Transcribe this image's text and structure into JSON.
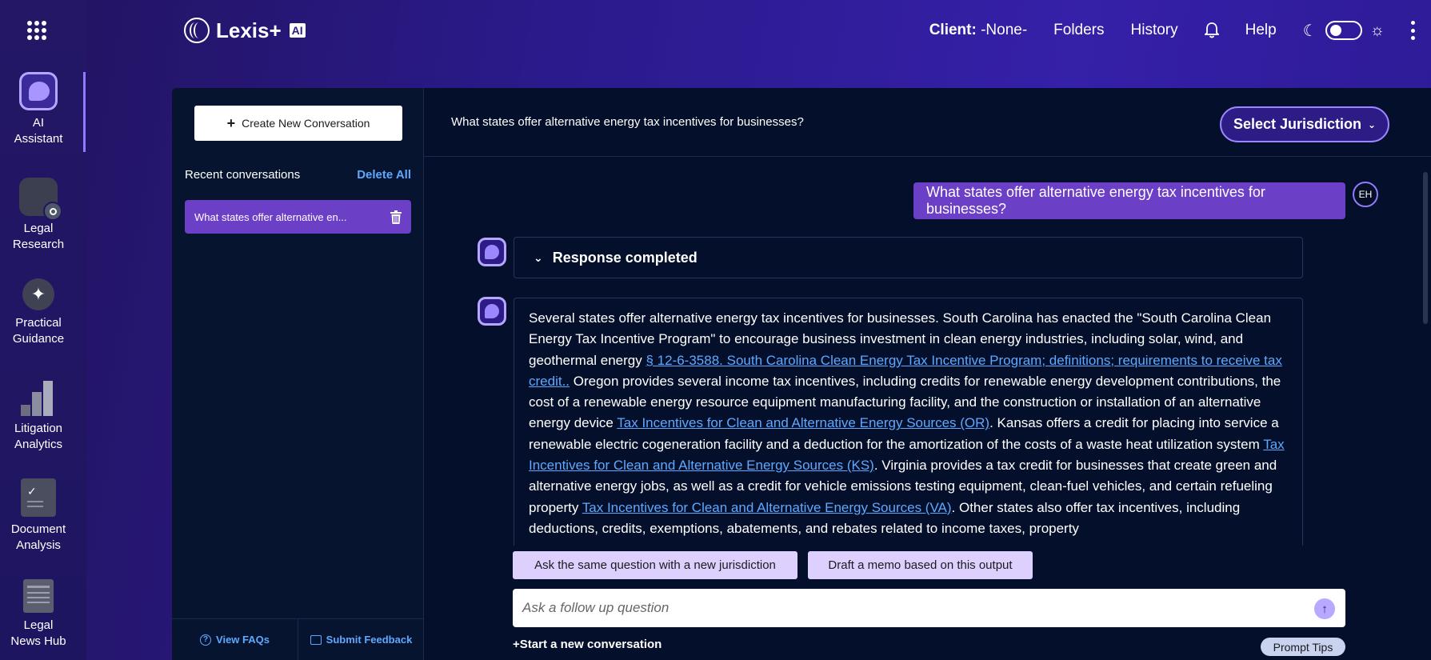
{
  "rail": {
    "items": [
      {
        "label1": "AI",
        "label2": "Assistant"
      },
      {
        "label1": "Legal",
        "label2": "Research"
      },
      {
        "label1": "Practical",
        "label2": "Guidance"
      },
      {
        "label1": "Litigation",
        "label2": "Analytics"
      },
      {
        "label1": "Document",
        "label2": "Analysis"
      },
      {
        "label1": "Legal",
        "label2": "News Hub"
      }
    ]
  },
  "header": {
    "brand": "Lexis+",
    "brand_badge": "AI",
    "client_label": "Client:",
    "client_value": "-None-",
    "folders": "Folders",
    "history": "History",
    "help": "Help"
  },
  "sidebar": {
    "new_conversation": "Create New Conversation",
    "recent_title": "Recent conversations",
    "delete_all": "Delete All",
    "conversations": [
      "What states offer alternative en..."
    ],
    "faq": "View FAQs",
    "feedback": "Submit Feedback"
  },
  "main": {
    "question": "What states offer alternative energy tax incentives for businesses?",
    "jurisdiction": "Select Jurisdiction",
    "user_message": "What states offer alternative energy tax incentives for businesses?",
    "user_initials": "EH",
    "status": "Response completed",
    "answer": {
      "p1": "Several states offer alternative energy tax incentives for businesses. South Carolina has enacted the \"South Carolina Clean Energy Tax Incentive Program\" to encourage business investment in clean energy industries, including solar, wind, and geothermal energy ",
      "l1": "§ 12-6-3588. South Carolina Clean Energy Tax Incentive Program; definitions; requirements to receive tax credit..",
      "p2": " Oregon provides several income tax incentives, including credits for renewable energy development contributions, the cost of a renewable energy resource equipment manufacturing facility, and the construction or installation of an alternative energy device ",
      "l2": "Tax Incentives for Clean and Alternative Energy Sources (OR)",
      "p3": ". Kansas offers a credit for placing into service a renewable electric cogeneration facility and a deduction for the amortization of the costs of a waste heat utilization system ",
      "l3": "Tax Incentives for Clean and Alternative Energy Sources (KS)",
      "p4": ". Virginia provides a tax credit for businesses that create green and alternative energy jobs, as well as a credit for vehicle emissions testing equipment, clean-fuel vehicles, and certain refueling property ",
      "l4": "Tax Incentives for Clean and Alternative Energy Sources (VA)",
      "p5": ". Other states also offer tax incentives, including deductions, credits, exemptions, abatements, and rebates related to income taxes, property"
    },
    "suggestion_1": "Ask the same question with a new jurisdiction",
    "suggestion_2": "Draft a memo based on this output",
    "followup_placeholder": "Ask a follow up question",
    "start_new": "+Start a new conversation",
    "prompt_tips": "Prompt Tips"
  },
  "colors": {
    "brand_purple": "#6c3fc7",
    "link": "#5fa8ff",
    "panel": "#04102b"
  }
}
